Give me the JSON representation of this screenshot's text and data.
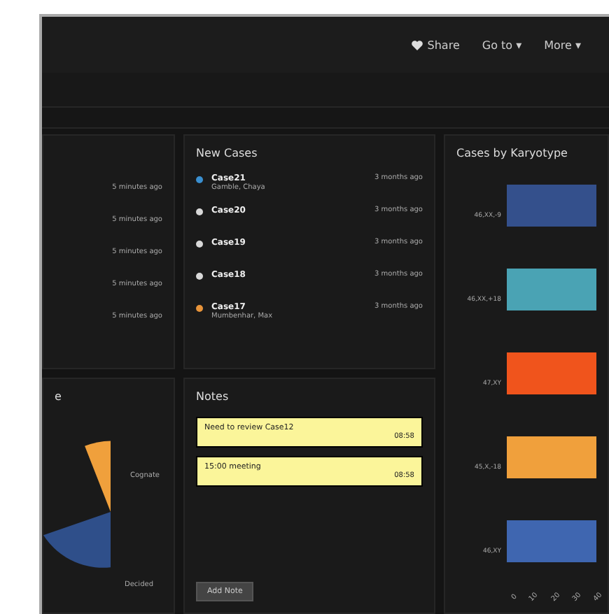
{
  "nav": [
    {
      "label": "Share"
    },
    {
      "label": "Go to ▾"
    },
    {
      "label": "More ▾"
    }
  ],
  "recent": {
    "times": [
      "5 minutes ago",
      "5 minutes ago",
      "5 minutes ago",
      "5 minutes ago",
      "5 minutes ago"
    ]
  },
  "new_cases": {
    "title": "New Cases",
    "items": [
      {
        "name": "Case21",
        "detail": "Gamble, Chaya",
        "time": "3 months ago",
        "color": "#3a8fd0"
      },
      {
        "name": "Case20",
        "time": "3 months ago",
        "color": "#d8d8d8"
      },
      {
        "name": "Case19",
        "time": "3 months ago",
        "color": "#d8d8d8"
      },
      {
        "name": "Case18",
        "time": "3 months ago",
        "color": "#d8d8d8"
      },
      {
        "name": "Case17",
        "detail": "Mumbenhar, Max",
        "time": "3 months ago",
        "color": "#e8943a"
      }
    ]
  },
  "pie_panel": {
    "title": "e",
    "labels": [
      "Cognate",
      "Decided"
    ]
  },
  "notes": {
    "title": "Notes",
    "items": [
      {
        "text": "Need to review Case12",
        "time": "08:58"
      },
      {
        "text": "15:00 meeting",
        "time": "08:58"
      }
    ],
    "button": "Add Note"
  },
  "karyotype": {
    "title": "Cases by Karyotype",
    "bars": [
      {
        "label": "46,XX,-9",
        "color": "#34508c"
      },
      {
        "label": "46,XX,+18",
        "color": "#4aa3b4"
      },
      {
        "label": "47,XY",
        "color": "#f0541c"
      },
      {
        "label": "45,X,-18",
        "color": "#f0a03c"
      },
      {
        "label": "46,XY",
        "color": "#3f66b0"
      }
    ],
    "ticks": [
      "0",
      "10",
      "20",
      "30",
      "40"
    ]
  }
}
